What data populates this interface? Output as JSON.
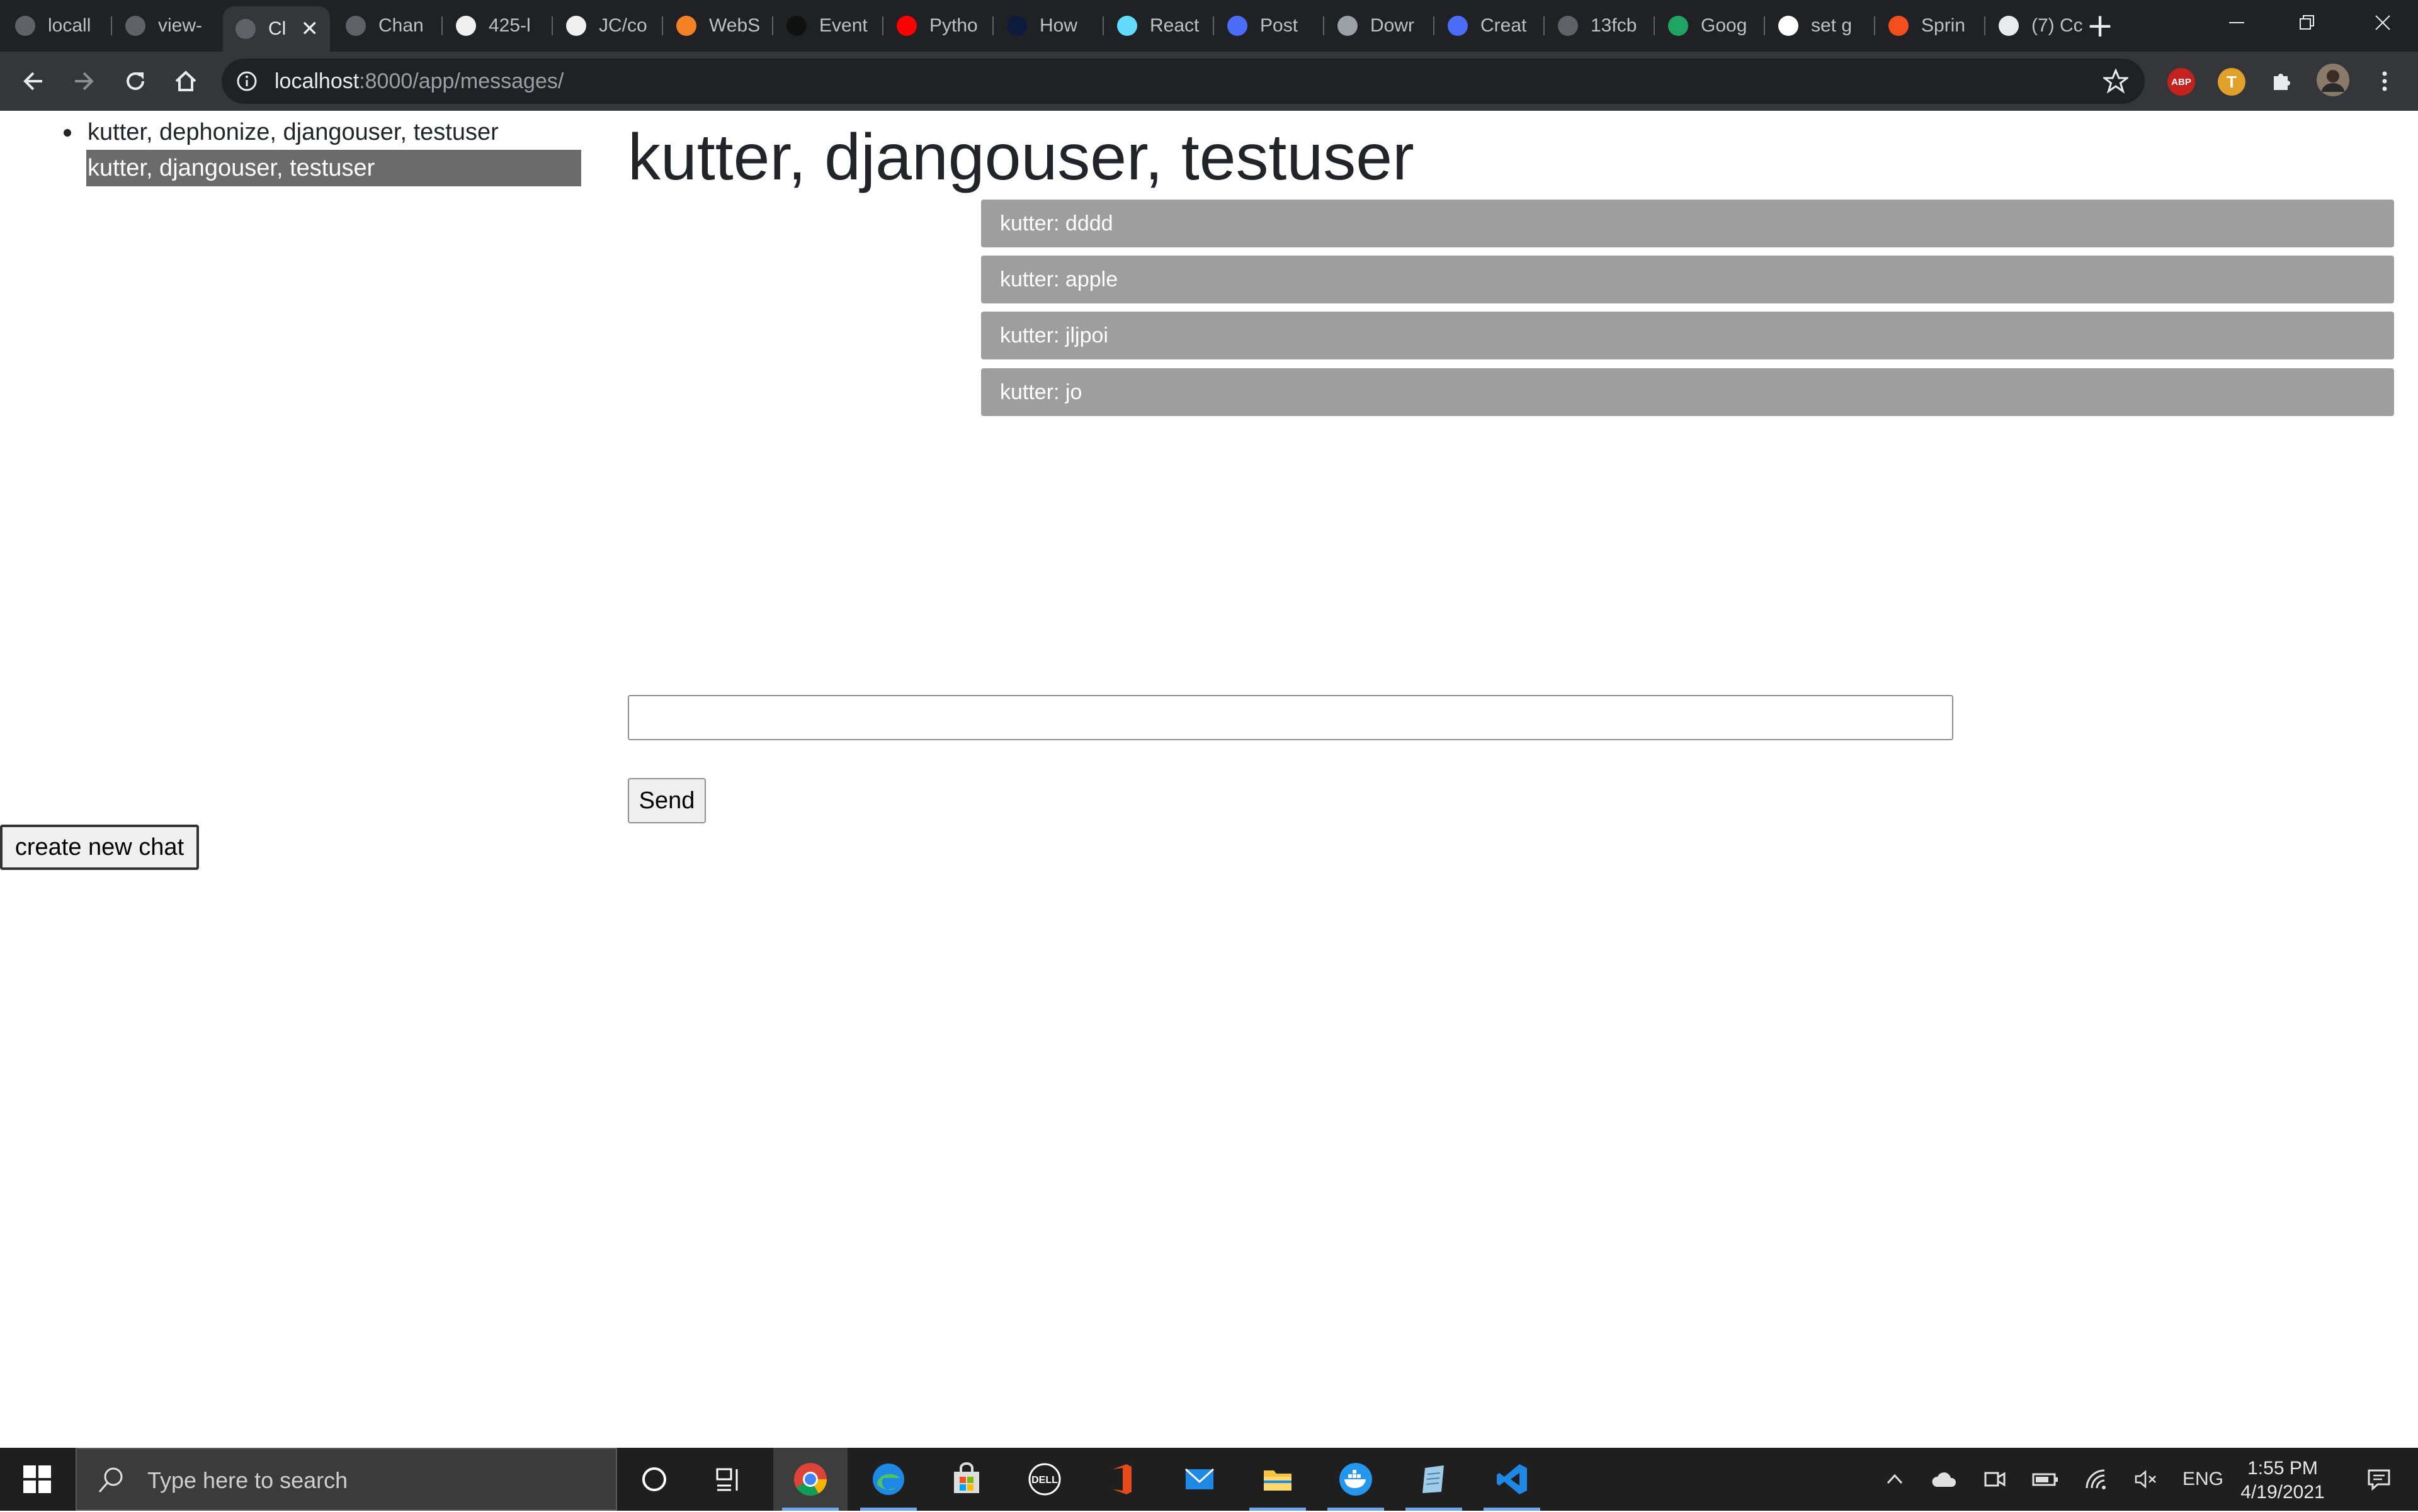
{
  "browser": {
    "tabs": [
      {
        "title": "locall",
        "icon": "globe-icon"
      },
      {
        "title": "view-",
        "icon": "globe-icon"
      },
      {
        "title": "Cl",
        "icon": "globe-icon"
      },
      {
        "title": "Chan",
        "icon": "globe-icon"
      },
      {
        "title": "425-l",
        "icon": "github-icon"
      },
      {
        "title": "JC/co",
        "icon": "github-icon"
      },
      {
        "title": "WebS",
        "icon": "stackoverflow-icon"
      },
      {
        "title": "Event",
        "icon": "dark-bird-icon"
      },
      {
        "title": "Pytho",
        "icon": "youtube-icon"
      },
      {
        "title": "How",
        "icon": "a-logo-icon"
      },
      {
        "title": "React",
        "icon": "react-icon"
      },
      {
        "title": "Post",
        "icon": "zoom-icon"
      },
      {
        "title": "Dowr",
        "icon": "database-icon"
      },
      {
        "title": "Creat",
        "icon": "zoom-icon"
      },
      {
        "title": "13fcb",
        "icon": "globe-icon"
      },
      {
        "title": "Goog",
        "icon": "google-drive-icon"
      },
      {
        "title": "set g",
        "icon": "google-icon"
      },
      {
        "title": "Sprin",
        "icon": "figma-icon"
      },
      {
        "title": "(7) Cc",
        "icon": "news-icon"
      }
    ],
    "active_tab_index": 2,
    "url_host": "localhost",
    "url_rest": ":8000/app/messages/",
    "extensions": [
      {
        "name": "adblock-plus-icon",
        "label": "ABP",
        "color": "#c4211f"
      },
      {
        "name": "tampermonkey-icon",
        "label": "T",
        "color": "#e0a12a"
      }
    ]
  },
  "page": {
    "chats": [
      {
        "label": "kutter, dephonize, djangouser, testuser",
        "selected": false
      },
      {
        "label": "kutter, djangouser, testuser",
        "selected": true
      }
    ],
    "chat_title": "kutter, djangouser, testuser",
    "messages": [
      "kutter: dddd",
      "kutter: apple",
      "kutter: jljpoi",
      "kutter: jo"
    ],
    "message_input_value": "",
    "send_label": "Send",
    "new_chat_label": "create new chat"
  },
  "taskbar": {
    "search_placeholder": "Type here to search",
    "language": "ENG",
    "time": "1:55 PM",
    "date": "4/19/2021"
  }
}
